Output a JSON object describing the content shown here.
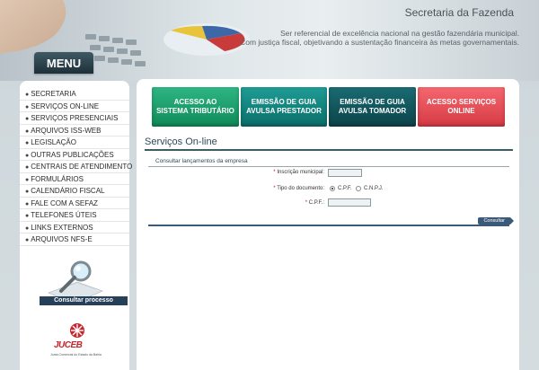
{
  "header": {
    "title": "Secretaria da Fazenda",
    "tagline_line1": "Ser referencial de excelência nacional na gestão fazendária municipal.",
    "tagline_line2": "Com justiça fiscal, objetivando a sustentação financeira às metas governamentais."
  },
  "sidebar": {
    "menu_label": "MENU",
    "items": [
      {
        "label": "SECRETARIA"
      },
      {
        "label": "SERVIÇOS ON-LINE"
      },
      {
        "label": "SERVIÇOS PRESENCIAIS"
      },
      {
        "label": "ARQUIVOS ISS-WEB"
      },
      {
        "label": "LEGISLAÇÃO"
      },
      {
        "label": "OUTRAS PUBLICAÇÕES"
      },
      {
        "label": "CENTRAIS DE ATENDIMENTO"
      },
      {
        "label": "FORMULÁRIOS"
      },
      {
        "label": "CALENDÁRIO FISCAL"
      },
      {
        "label": "FALE COM A SEFAZ"
      },
      {
        "label": "TELEFONES ÚTEIS"
      },
      {
        "label": "LINKS EXTERNOS"
      },
      {
        "label": "ARQUIVOS NFS-E"
      }
    ],
    "consult_label": "Consultar processo",
    "juceb_name": "JUCEB",
    "juceb_sub": "Junta Comercial do Estado da Bahia"
  },
  "actions": {
    "btn1_line1": "ACESSO AO",
    "btn1_line2": "SISTEMA TRIBUTÁRIO",
    "btn2_line1": "EMISSÃO DE GUIA",
    "btn2_line2": "AVULSA PRESTADOR",
    "btn3_line1": "EMISSÃO DE GUIA",
    "btn3_line2": "AVULSA TOMADOR",
    "btn4_line1": "ACESSO SERVIÇOS",
    "btn4_line2": "ONLINE"
  },
  "main": {
    "section_title": "Serviços On-line",
    "form_legend": "Consultar lançamentos da empresa",
    "required_mark": "*",
    "inscricao_label": "Inscrição municipal:",
    "inscricao_value": "",
    "tipo_label": "Tipo do documento:",
    "radio_cpf": "C.P.F.",
    "radio_cnpj": "C.N.P.J.",
    "cpf_label": "C.P.F.:",
    "cpf_value": "",
    "submit_label": "Consultar"
  },
  "colors": {
    "btn_green": "#1fa671",
    "btn_teal": "#158580",
    "btn_dark_teal": "#12565d",
    "btn_red": "#e54f58",
    "menu_tab": "#2c4450"
  }
}
